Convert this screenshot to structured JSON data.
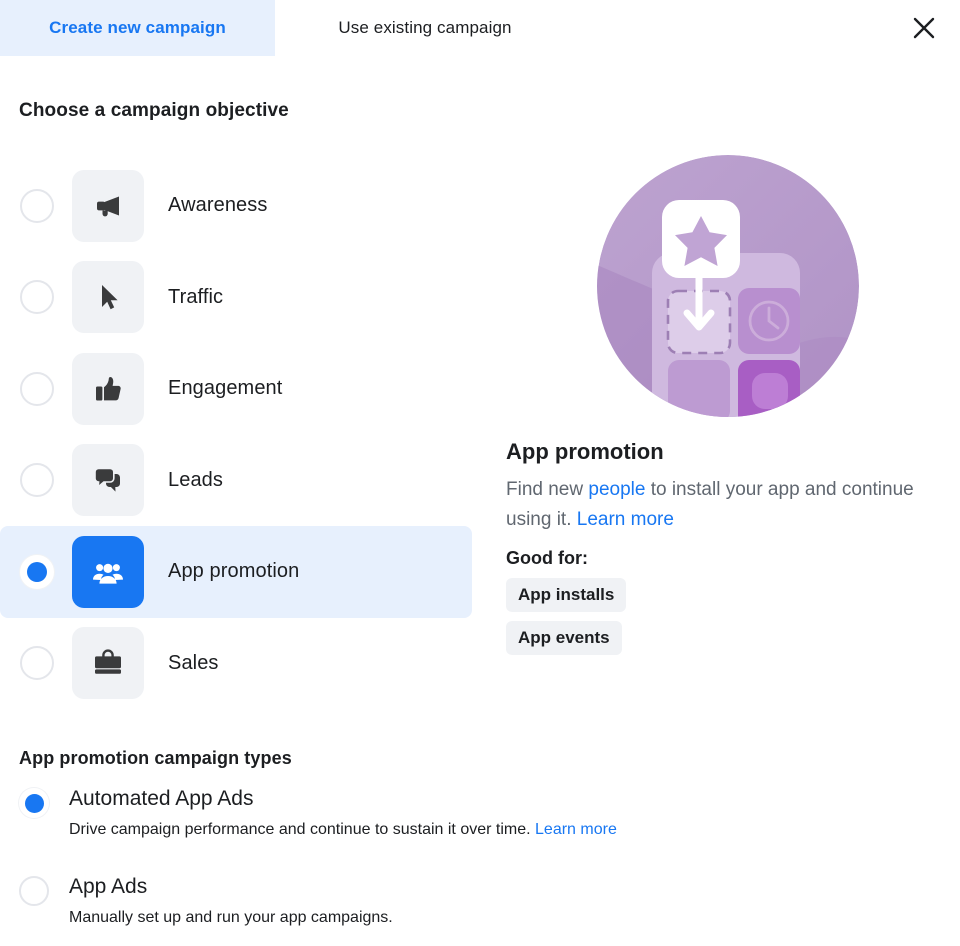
{
  "tabs": [
    {
      "label": "Create new campaign",
      "active": true
    },
    {
      "label": "Use existing campaign",
      "active": false
    }
  ],
  "close_icon": "close-icon",
  "objective_section": {
    "title": "Choose a campaign objective",
    "items": [
      {
        "label": "Awareness",
        "icon": "megaphone-icon",
        "selected": false
      },
      {
        "label": "Traffic",
        "icon": "cursor-icon",
        "selected": false
      },
      {
        "label": "Engagement",
        "icon": "thumbs-up-icon",
        "selected": false
      },
      {
        "label": "Leads",
        "icon": "speech-bubbles-icon",
        "selected": false
      },
      {
        "label": "App promotion",
        "icon": "people-group-icon",
        "selected": true
      },
      {
        "label": "Sales",
        "icon": "briefcase-icon",
        "selected": false
      }
    ]
  },
  "detail": {
    "illustration": "app-install-illustration",
    "title": "App promotion",
    "desc_part1": "Find new ",
    "desc_link1": "people",
    "desc_part2": " to install your app and continue using it. ",
    "desc_link2": "Learn more",
    "good_for_label": "Good for:",
    "chips": [
      "App installs",
      "App events"
    ]
  },
  "campaign_types": {
    "title": "App promotion campaign types",
    "options": [
      {
        "name": "Automated App Ads",
        "desc": "Drive campaign performance and continue to sustain it over time. ",
        "link": "Learn more",
        "selected": true
      },
      {
        "name": "App Ads",
        "desc": "Manually set up and run your app campaigns.",
        "link": "",
        "selected": false
      }
    ]
  },
  "colors": {
    "accent_blue": "#1877f2",
    "selected_row_bg": "#e7f0fd",
    "tile_gray": "#f0f2f5",
    "icon_dark": "#3a3b3c",
    "text_secondary": "#606770",
    "illustration_purple": "#b49ac8",
    "illustration_purple_dark": "#9b5fb5",
    "illustration_purple_light": "#d4c2e0"
  }
}
